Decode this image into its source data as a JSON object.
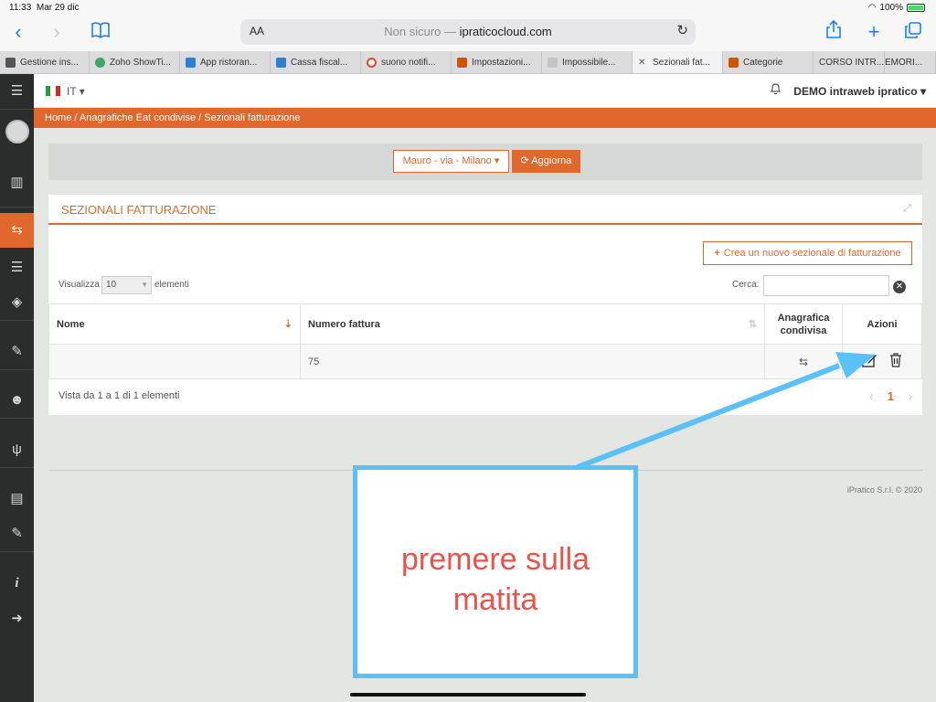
{
  "status": {
    "time": "11:33",
    "date": "Mar 29 dic",
    "battery": "100%"
  },
  "browser": {
    "aa": "AA",
    "not_secure": "Non sicuro —",
    "domain": "ipraticocloud.com",
    "tabs": [
      {
        "label": "Gestione ins...",
        "color": "#555555"
      },
      {
        "label": "Zoho ShowTi...",
        "color": "#3fa56b"
      },
      {
        "label": "App ristoran...",
        "color": "#2d7fd6"
      },
      {
        "label": "Cassa fiscal...",
        "color": "#2d7fd6"
      },
      {
        "label": "suono notifi...",
        "color": "#ea4335"
      },
      {
        "label": "Impostazioni...",
        "color": "#d35400"
      },
      {
        "label": "Impossibile...",
        "color": "#c4c4c4"
      },
      {
        "label": "Sezionali fat...",
        "color": "#777777"
      },
      {
        "label": "Categorie",
        "color": "#d35400"
      },
      {
        "label": "CORSO INTR...",
        "color": ""
      },
      {
        "label": "EMORI...",
        "color": ""
      }
    ]
  },
  "topbar": {
    "lang": "IT ▾",
    "user": "DEMO intraweb ipratico ▾"
  },
  "breadcrumb": "Home   /  Anagrafiche Eat condivise / Sezionali fatturazione",
  "filter": {
    "location": "Mauro - via - Milano ▾",
    "refresh": "⟳ Aggiorna"
  },
  "panel": {
    "title": "SEZIONALI FATTURAZIONE",
    "create": "Crea un nuovo sezionale di fatturazione",
    "show_label": "Visualizza",
    "show_value": "10",
    "show_label2": "elementi",
    "search_label": "Cerca:",
    "columns": [
      "Nome",
      "Numero fattura",
      "Anagrafica condivisa",
      "Azioni"
    ],
    "rows": [
      {
        "nome": "",
        "numero": "75"
      }
    ],
    "info": "Vista da 1 a 1 di 1 elementi",
    "page": "1"
  },
  "footer": "iPratico S.r.l. © 2020",
  "annotation": "premere sulla matita",
  "colors": {
    "accent": "#e1682d",
    "annotation_border": "#5bc0f6",
    "annotation_text": "#e8534a"
  }
}
